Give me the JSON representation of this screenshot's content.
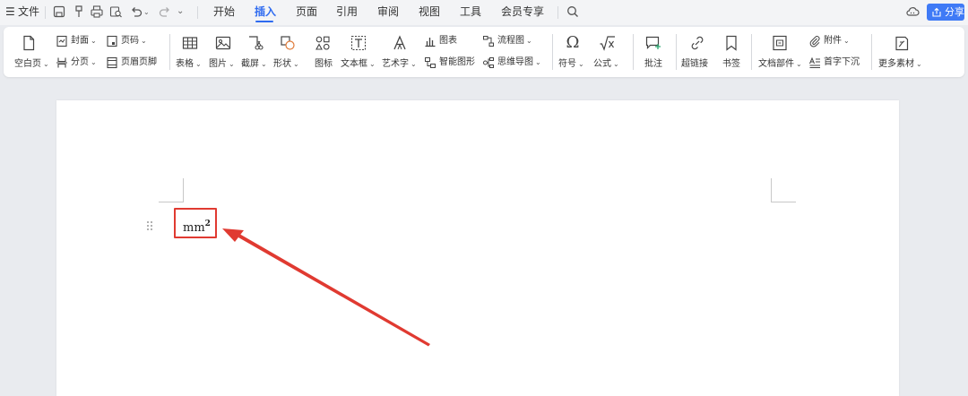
{
  "menubar": {
    "hamburger": "☰",
    "file_label": "文件",
    "tabs": [
      "开始",
      "插入",
      "页面",
      "引用",
      "审阅",
      "视图",
      "工具",
      "会员专享"
    ],
    "active_tab": "插入",
    "share_label": "分享"
  },
  "ribbon": {
    "blank_page": "空白页",
    "cover": "封面",
    "page_number": "页码",
    "page_break": "分页",
    "header_footer": "页眉页脚",
    "table": "表格",
    "picture": "图片",
    "screenshot": "截屏",
    "shape": "形状",
    "icons": "图标",
    "textbox": "文本框",
    "wordart": "艺术字",
    "chart": "图表",
    "smartart": "智能图形",
    "flowchart": "流程图",
    "mindmap": "思维导图",
    "symbol": "符号",
    "formula": "公式",
    "comment": "批注",
    "hyperlink": "超链接",
    "bookmark": "书签",
    "doc_parts": "文档部件",
    "attachment": "附件",
    "drop_cap": "首字下沉",
    "more_materials": "更多素材"
  },
  "document": {
    "text_main": "mm",
    "text_superscript": "2"
  },
  "colors": {
    "accent": "#2f6bf0",
    "highlight": "#e03a31",
    "share_button": "#3f7af6"
  }
}
